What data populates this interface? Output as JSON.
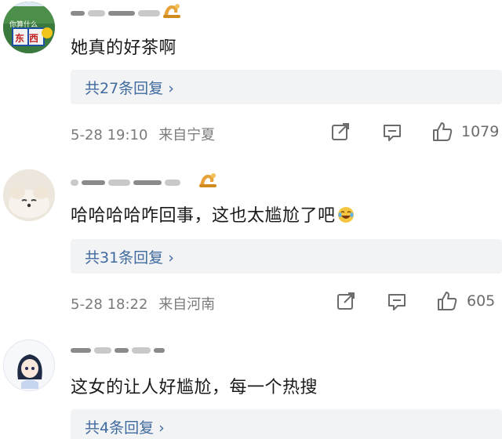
{
  "comments": [
    {
      "text": "她真的好茶啊",
      "replies": "共27条回复 ›",
      "date": "5-28 19:10",
      "location": "来自宁夏",
      "likes": "1079",
      "avatar_text_top": "你算什么",
      "avatar_text_main": "东西"
    },
    {
      "text": "哈哈哈哈咋回事，这也太尴尬了吧",
      "replies": "共31条回复 ›",
      "date": "5-28 18:22",
      "location": "来自河南",
      "likes": "605"
    },
    {
      "text": "这女的让人好尴尬，每一个热搜",
      "replies": "共4条回复 ›"
    }
  ],
  "icons": {
    "share": "share-icon",
    "comment": "comment-icon",
    "like": "thumbs-up-icon",
    "badge": "fan-badge-icon"
  },
  "colors": {
    "reply_link": "#3f6a9e",
    "meta_text": "#7a7a7a",
    "reply_bg": "#f2f3f5"
  }
}
